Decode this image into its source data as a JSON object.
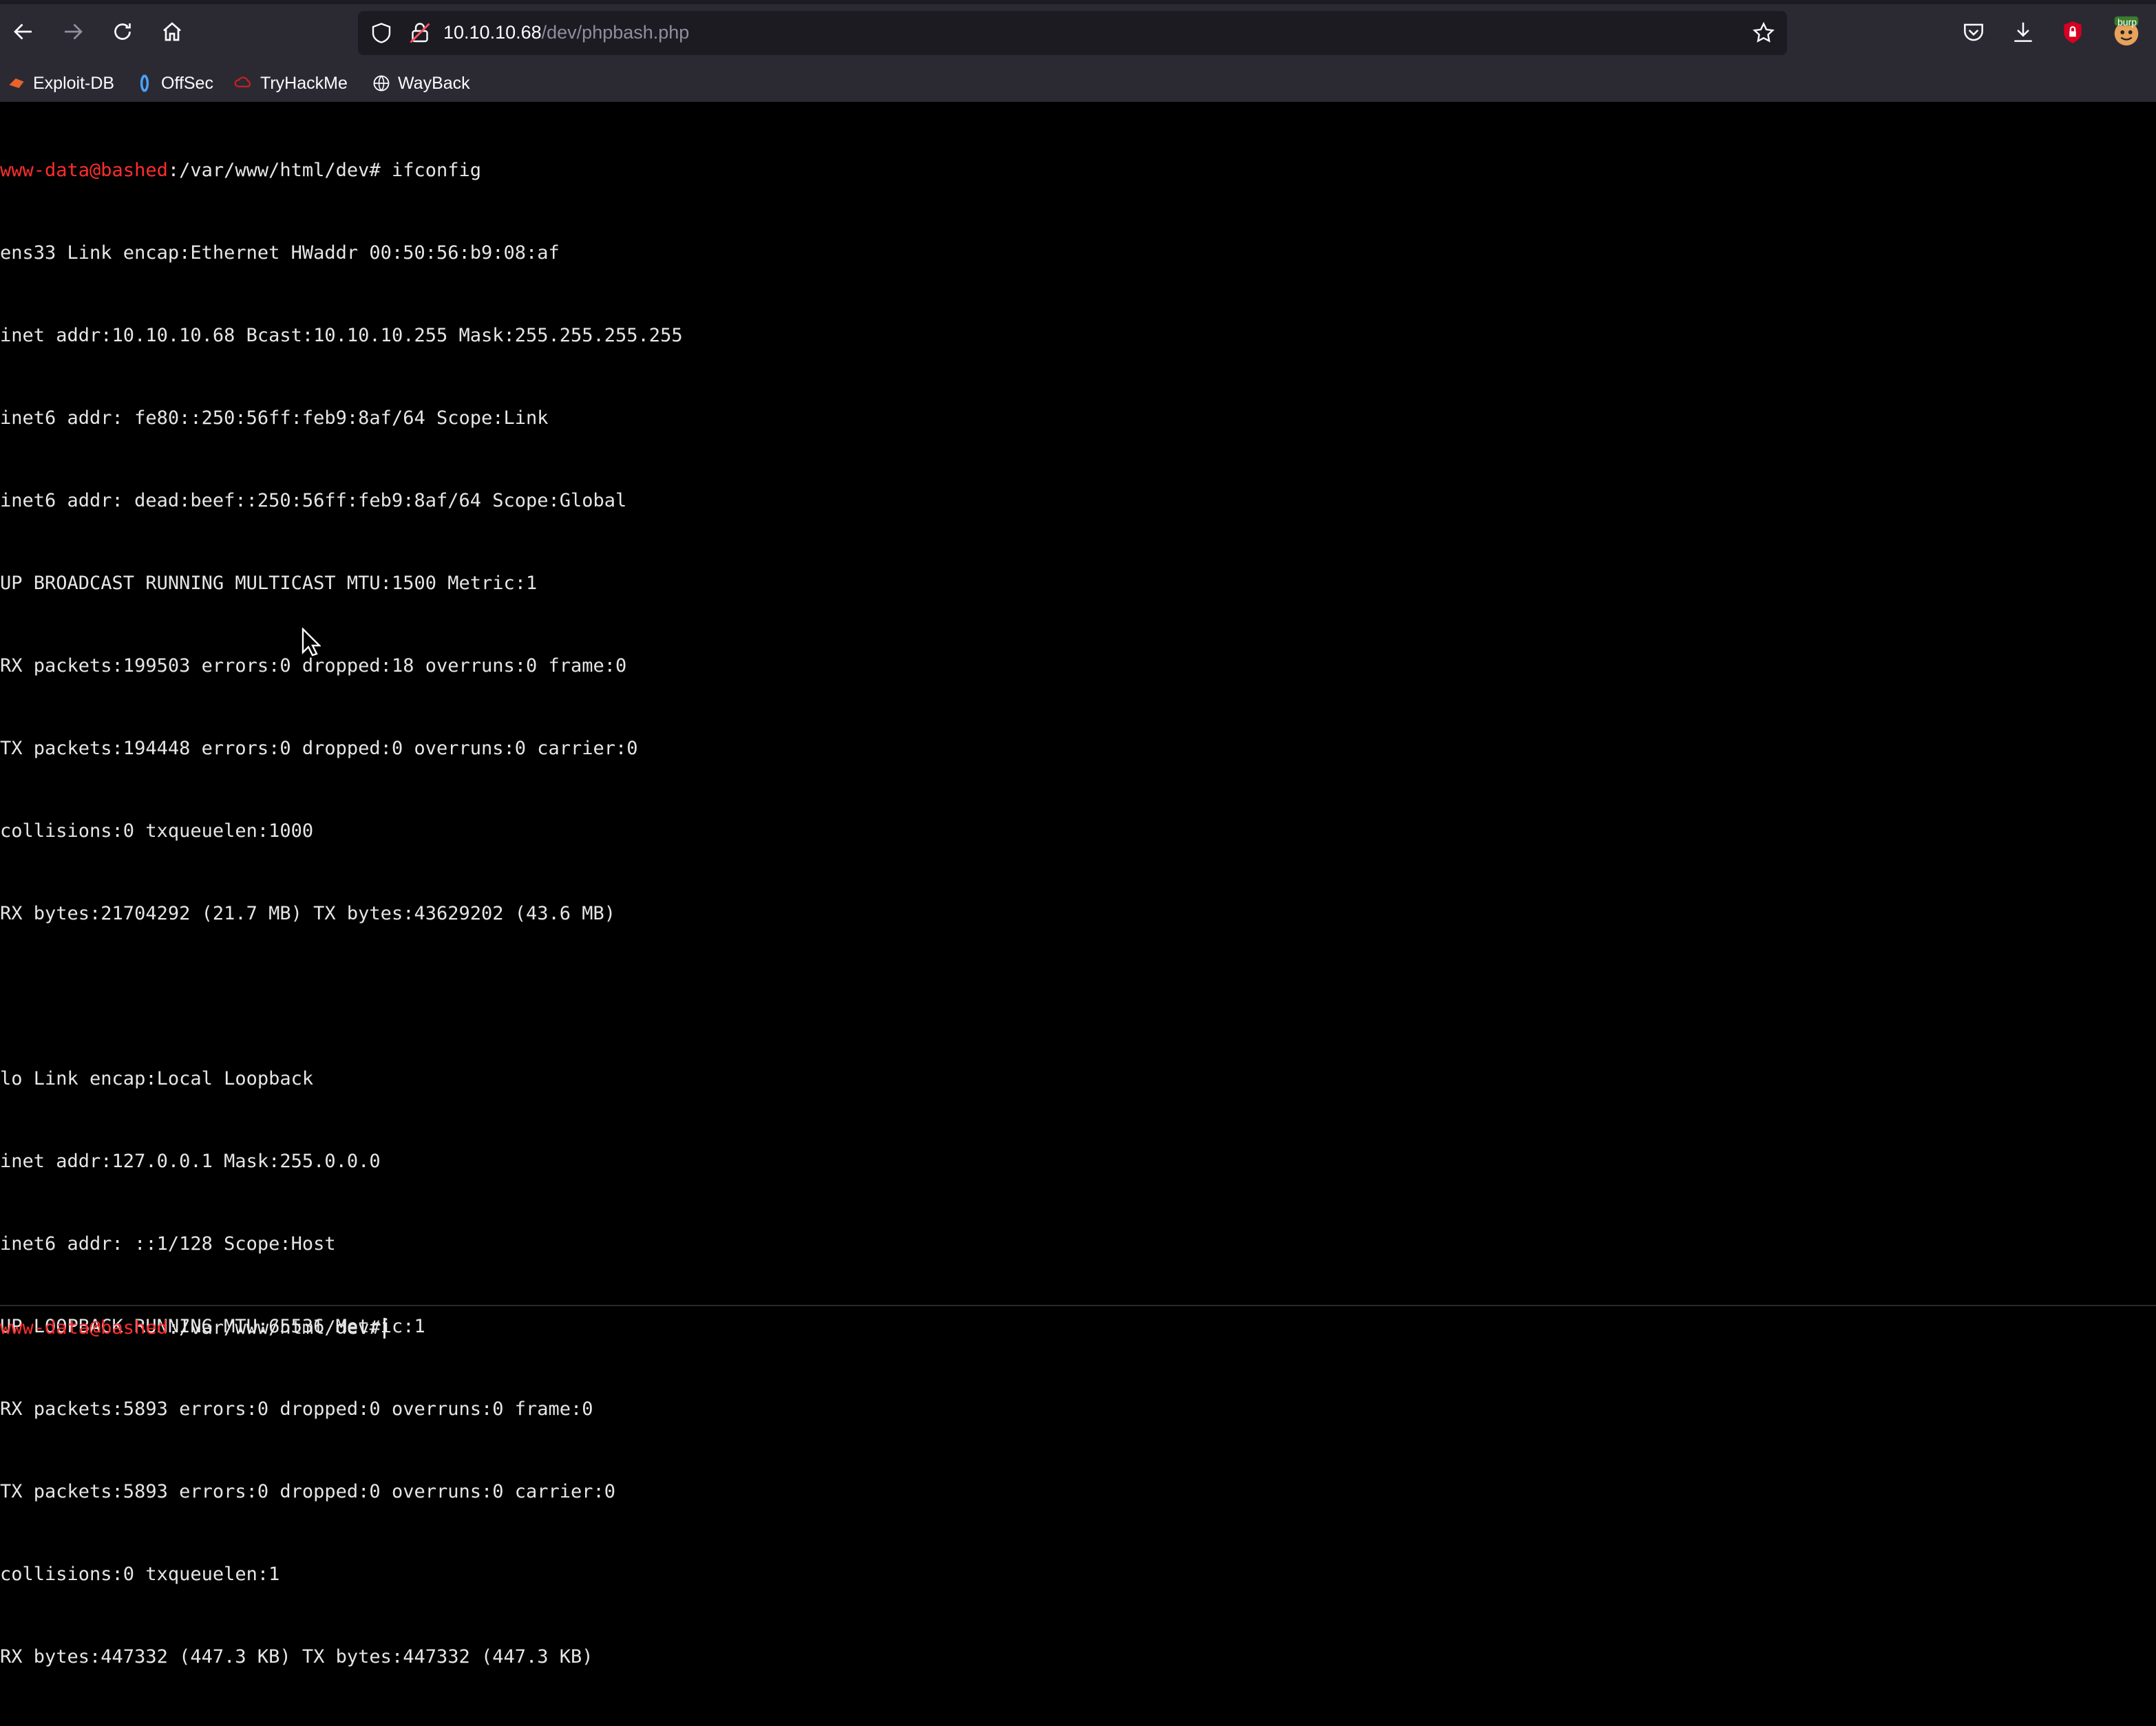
{
  "browser": {
    "url_host": "10.10.10.68",
    "url_path": "/dev/phpbash.php",
    "extension_badge": "burp"
  },
  "bookmarks": [
    {
      "label": "Exploit-DB",
      "icon": "exploitdb-icon"
    },
    {
      "label": "OffSec",
      "icon": "offsec-icon"
    },
    {
      "label": "TryHackMe",
      "icon": "tryhackme-icon"
    },
    {
      "label": "WayBack",
      "icon": "globe-icon"
    }
  ],
  "terminal": {
    "prompt_user": "www-data@bashed",
    "prompt_path": ":/var/www/html/dev#",
    "command": " ifconfig",
    "output": [
      "ens33 Link encap:Ethernet HWaddr 00:50:56:b9:08:af",
      "inet addr:10.10.10.68 Bcast:10.10.10.255 Mask:255.255.255.255",
      "inet6 addr: fe80::250:56ff:feb9:8af/64 Scope:Link",
      "inet6 addr: dead:beef::250:56ff:feb9:8af/64 Scope:Global",
      "UP BROADCAST RUNNING MULTICAST MTU:1500 Metric:1",
      "RX packets:199503 errors:0 dropped:18 overruns:0 frame:0",
      "TX packets:194448 errors:0 dropped:0 overruns:0 carrier:0",
      "collisions:0 txqueuelen:1000",
      "RX bytes:21704292 (21.7 MB) TX bytes:43629202 (43.6 MB)",
      "",
      "lo Link encap:Local Loopback",
      "inet addr:127.0.0.1 Mask:255.0.0.0",
      "inet6 addr: ::1/128 Scope:Host",
      "UP LOOPBACK RUNNING MTU:65536 Metric:1",
      "RX packets:5893 errors:0 dropped:0 overruns:0 frame:0",
      "TX packets:5893 errors:0 dropped:0 overruns:0 carrier:0",
      "collisions:0 txqueuelen:1",
      "RX bytes:447332 (447.3 KB) TX bytes:447332 (447.3 KB)"
    ],
    "input_value": ""
  },
  "colors": {
    "prompt_user": "#ff2d2d",
    "terminal_bg": "#000000",
    "terminal_fg": "#e6e6e6",
    "chrome_bg": "#2b2a33"
  }
}
